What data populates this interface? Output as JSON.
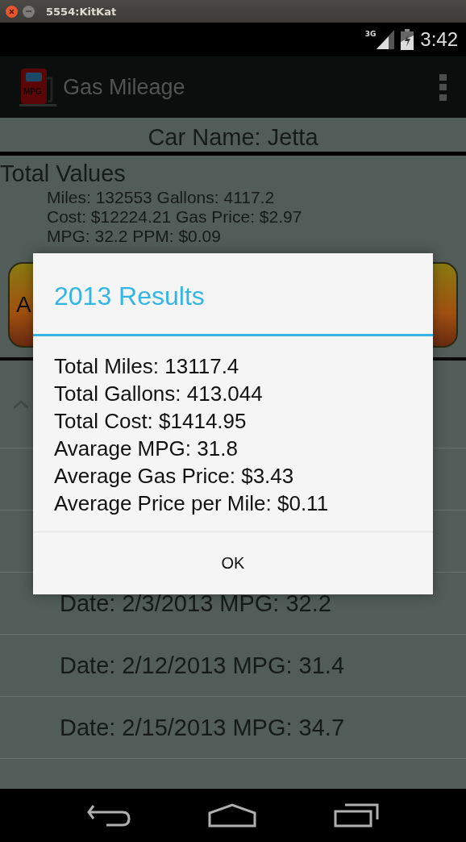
{
  "window": {
    "title": "5554:KitKat"
  },
  "status_bar": {
    "network": "3G",
    "time": "3:42"
  },
  "action_bar": {
    "icon_label": "MPG",
    "title": "Gas Mileage"
  },
  "car_name": "Car Name: Jetta",
  "totals": {
    "heading": "Total Values",
    "lines": [
      "Miles: 132553 Gallons: 4117.2",
      "Cost: $12224.21 Gas Price: $2.97",
      "MPG: 32.2 PPM: $0.09"
    ]
  },
  "buttons": [
    {
      "kind": "labeled",
      "label": "A"
    },
    {
      "kind": "covered"
    }
  ],
  "year_group": {
    "expanded": true
  },
  "entries": [
    "Date: 2/3/2013 MPG: 32.2",
    "Date: 2/12/2013 MPG: 31.4",
    "Date: 2/15/2013 MPG: 34.7"
  ],
  "dialog": {
    "title": "2013 Results",
    "lines": [
      "Total Miles: 13117.4",
      "Total Gallons: 413.044",
      "Total Cost: $1414.95",
      "Avarage MPG: 31.8",
      "Average Gas Price: $3.43",
      "Average Price per Mile: $0.11"
    ],
    "button": "OK"
  }
}
